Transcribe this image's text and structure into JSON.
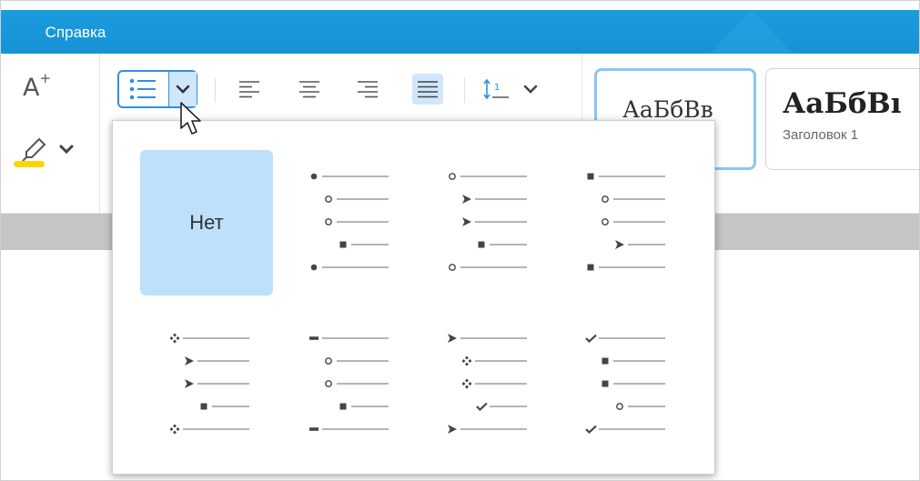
{
  "tabbar": {
    "active_tab": "Справка"
  },
  "toolbar": {
    "font_increase": {
      "label": "A",
      "sup": "+",
      "icon": "font-size-increase-icon"
    },
    "highlight": {
      "icon": "highlighter-icon",
      "color": "#ffd400"
    },
    "list_button": {
      "icon": "bulleted-list-icon",
      "arrow": "chevron-down-icon",
      "active_color": "#2f8fe0"
    },
    "alignment": [
      "align-left",
      "align-center",
      "align-right",
      "align-justify"
    ],
    "active_alignment": "align-justify",
    "line_spacing": {
      "icon": "line-spacing-icon"
    }
  },
  "styles": [
    {
      "sample": "АаБбВв",
      "caption": ""
    },
    {
      "sample": "АаБбВı",
      "caption": "Заголовок 1"
    }
  ],
  "dropdown": {
    "none_label": "Нет",
    "options": [
      {
        "id": "none"
      },
      {
        "id": "bullet-1",
        "markers": [
          "disc",
          "circle",
          "circle",
          "square",
          "disc"
        ]
      },
      {
        "id": "bullet-2",
        "markers": [
          "circle",
          "arrow",
          "arrow",
          "square",
          "circle"
        ]
      },
      {
        "id": "bullet-3",
        "markers": [
          "square",
          "circle",
          "circle",
          "arrow",
          "square"
        ]
      },
      {
        "id": "bullet-4",
        "markers": [
          "diamond",
          "arrow",
          "arrow",
          "square",
          "diamond"
        ]
      },
      {
        "id": "bullet-5",
        "markers": [
          "dash",
          "circle",
          "circle",
          "square",
          "dash"
        ]
      },
      {
        "id": "bullet-6",
        "markers": [
          "arrow",
          "diamond",
          "diamond",
          "check",
          "arrow"
        ]
      },
      {
        "id": "bullet-7",
        "markers": [
          "check",
          "square",
          "square",
          "circle",
          "check"
        ]
      }
    ]
  }
}
